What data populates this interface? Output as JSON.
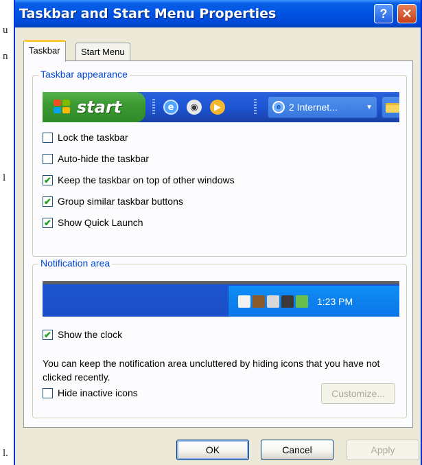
{
  "background_text": [
    "u",
    "n",
    "l",
    "l."
  ],
  "window": {
    "title": "Taskbar and Start Menu Properties",
    "help_label": "?",
    "close_label": "✕"
  },
  "tabs": [
    {
      "label": "Taskbar",
      "active": true
    },
    {
      "label": "Start Menu",
      "active": false
    }
  ],
  "taskbar_appearance": {
    "legend": "Taskbar appearance",
    "preview": {
      "start_label": "start",
      "quick_launch_icons": [
        "internet-explorer-icon",
        "media-player-icon",
        "media-icon"
      ],
      "task_button_label": "2 Internet...",
      "task_button_icon": "internet-explorer-icon",
      "folder_icon": "folder-icon"
    },
    "options": [
      {
        "label": "Lock the taskbar",
        "checked": false
      },
      {
        "label": "Auto-hide the taskbar",
        "checked": false
      },
      {
        "label": "Keep the taskbar on top of other windows",
        "checked": true
      },
      {
        "label": "Group similar taskbar buttons",
        "checked": true
      },
      {
        "label": "Show Quick Launch",
        "checked": true
      }
    ]
  },
  "notification_area": {
    "legend": "Notification area",
    "clock_time": "1:23 PM",
    "tray_icons": [
      "tray-icon-1",
      "tray-icon-2",
      "tray-icon-3",
      "tray-icon-4",
      "tray-icon-5"
    ],
    "options": [
      {
        "label": "Show the clock",
        "checked": true
      },
      {
        "label": "Hide inactive icons",
        "checked": false
      }
    ],
    "description": "You can keep the notification area uncluttered by hiding icons that you have not clicked recently.",
    "customize_label": "Customize..."
  },
  "buttons": {
    "ok": "OK",
    "cancel": "Cancel",
    "apply": "Apply"
  },
  "colors": {
    "title_bar": "#0054e3",
    "taskbar": "#245edb",
    "start_button": "#3c9a32",
    "tray": "#0b75e8",
    "legend_text": "#0046d5",
    "dialog_bg": "#ece9d8"
  }
}
